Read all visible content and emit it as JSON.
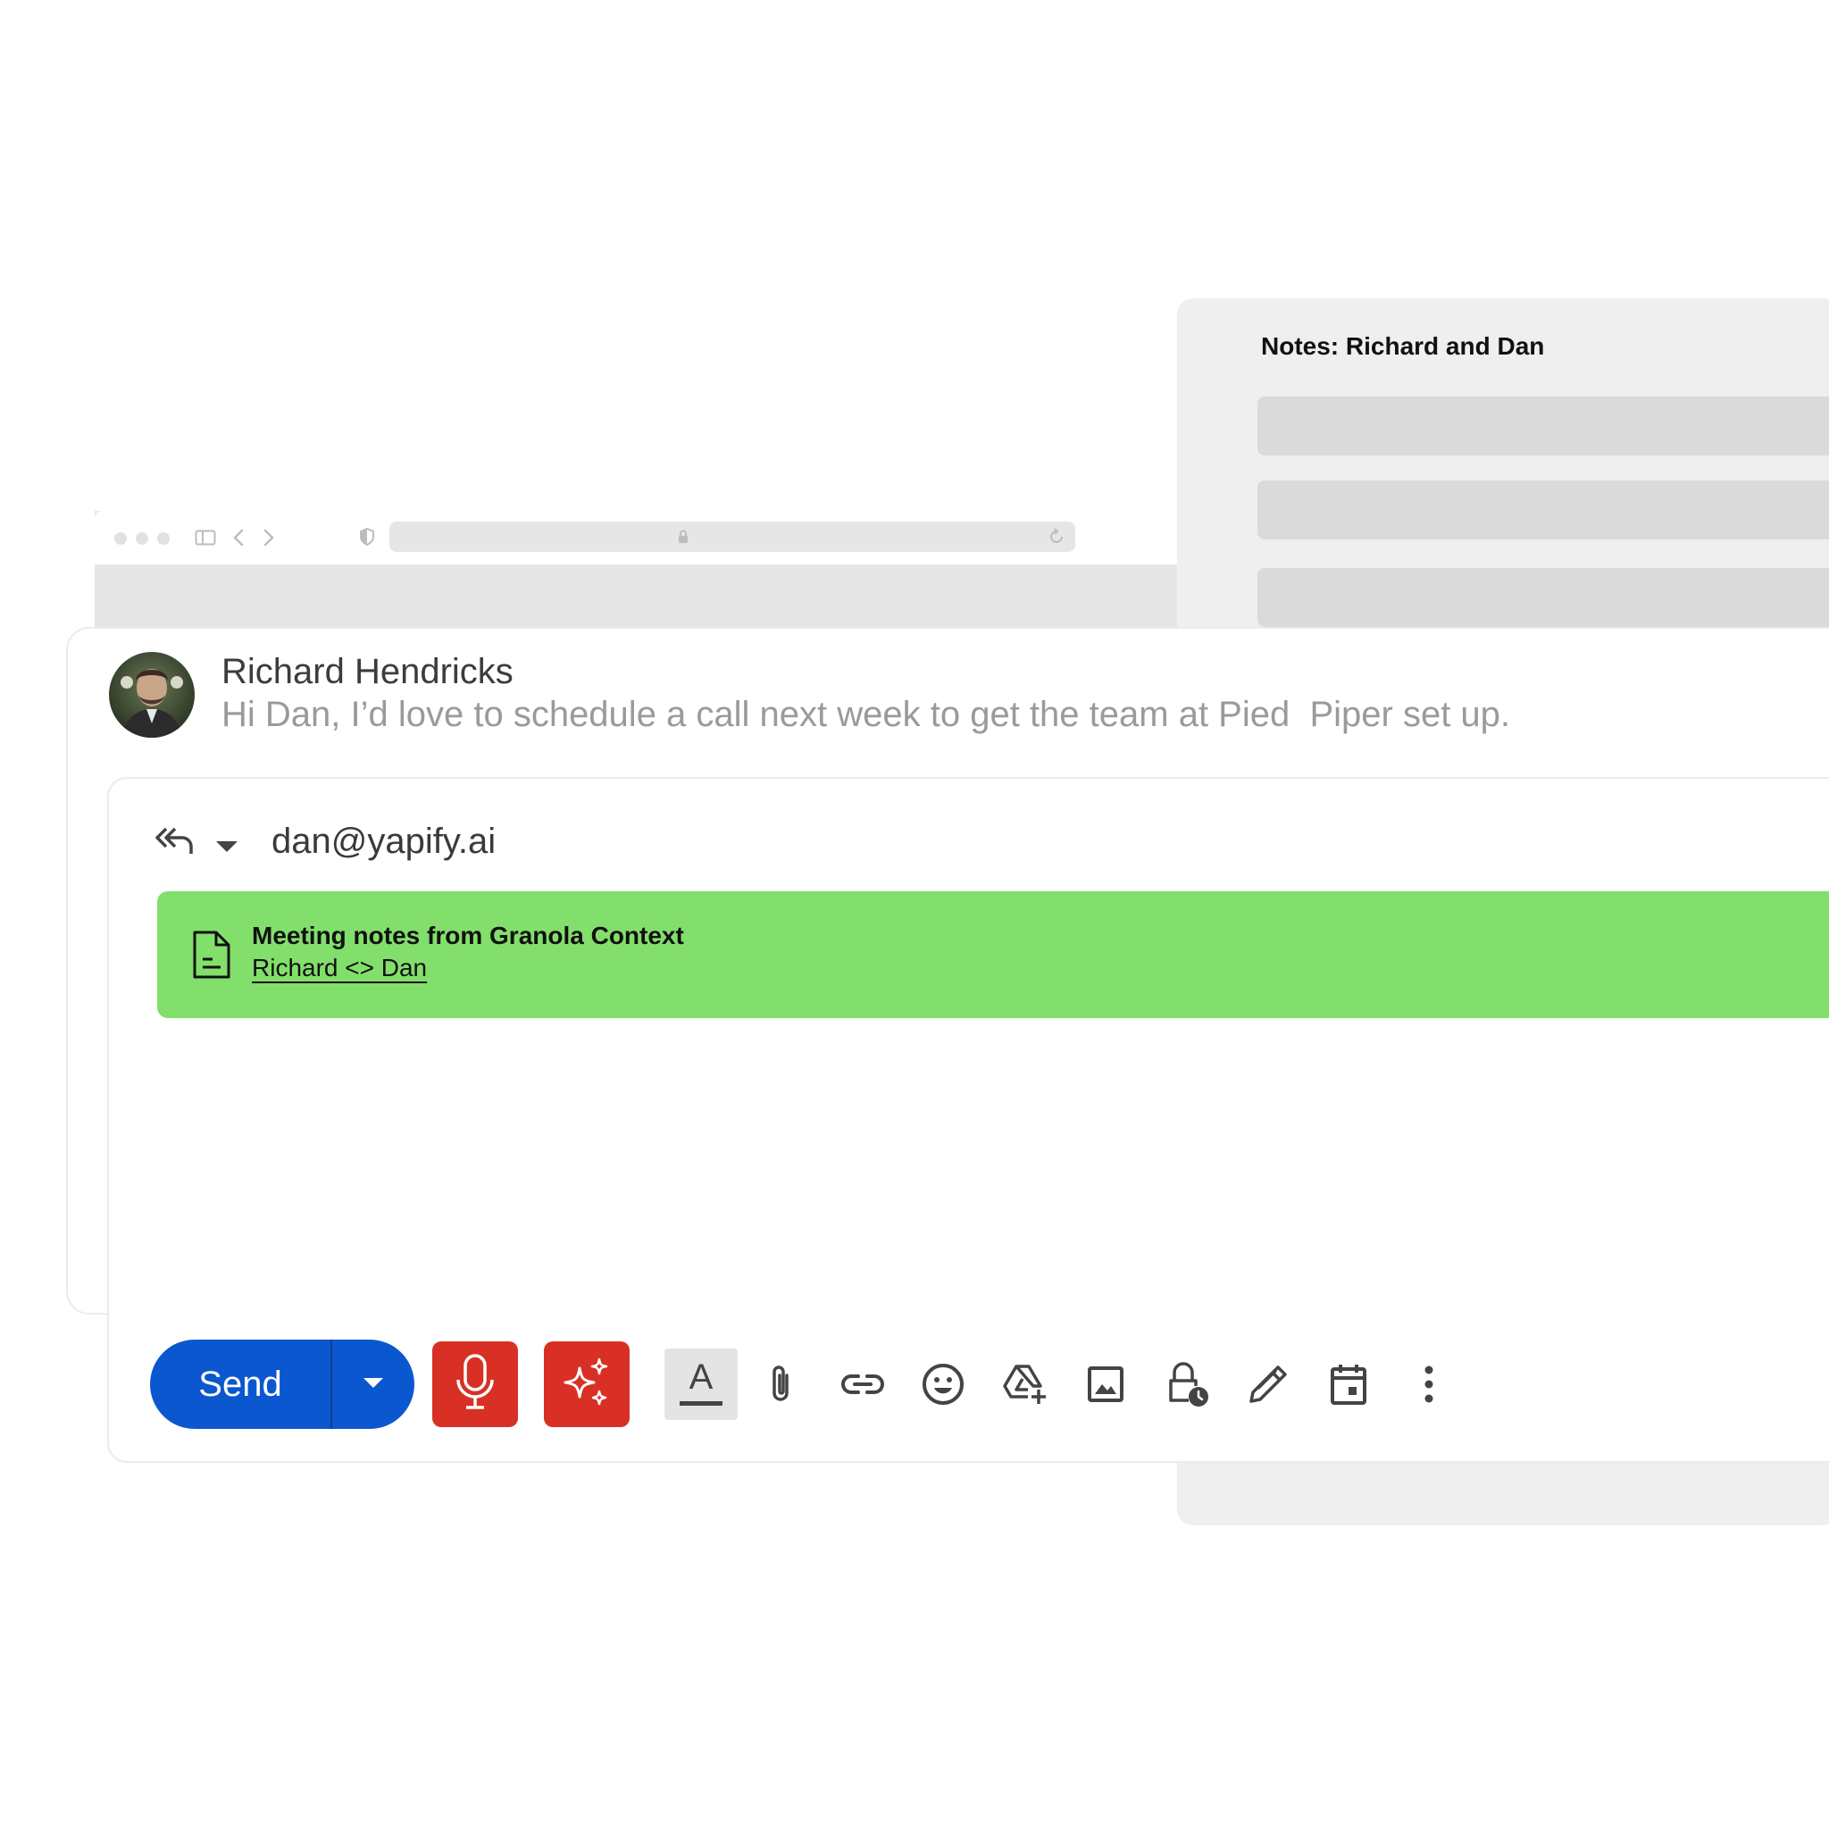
{
  "notes_panel": {
    "title": "Notes: Richard and Dan"
  },
  "browser": {
    "toolbar_icons": [
      "sidebar-icon",
      "back-icon",
      "forward-icon",
      "shield-icon",
      "lock-icon",
      "reload-icon"
    ]
  },
  "email": {
    "sender": "Richard Hendricks",
    "snippet": "Hi Dan, I’d love to schedule a call next week to get the team at Pied  Piper set up."
  },
  "reply": {
    "recipient": "dan@yapify.ai",
    "context": {
      "title": "Meeting notes from Granola Context",
      "link": "Richard <> Dan"
    }
  },
  "toolbar": {
    "send_label": "Send",
    "format_letter": "A",
    "icons": [
      "attach-icon",
      "link-icon",
      "emoji-icon",
      "drive-icon",
      "image-icon",
      "confidential-icon",
      "signature-icon",
      "calendar-icon",
      "more-options-icon"
    ]
  },
  "colors": {
    "send_blue": "#0b57d0",
    "ai_red": "#d93025",
    "banner_green": "#82df6b",
    "notes_bg": "#efefef"
  }
}
